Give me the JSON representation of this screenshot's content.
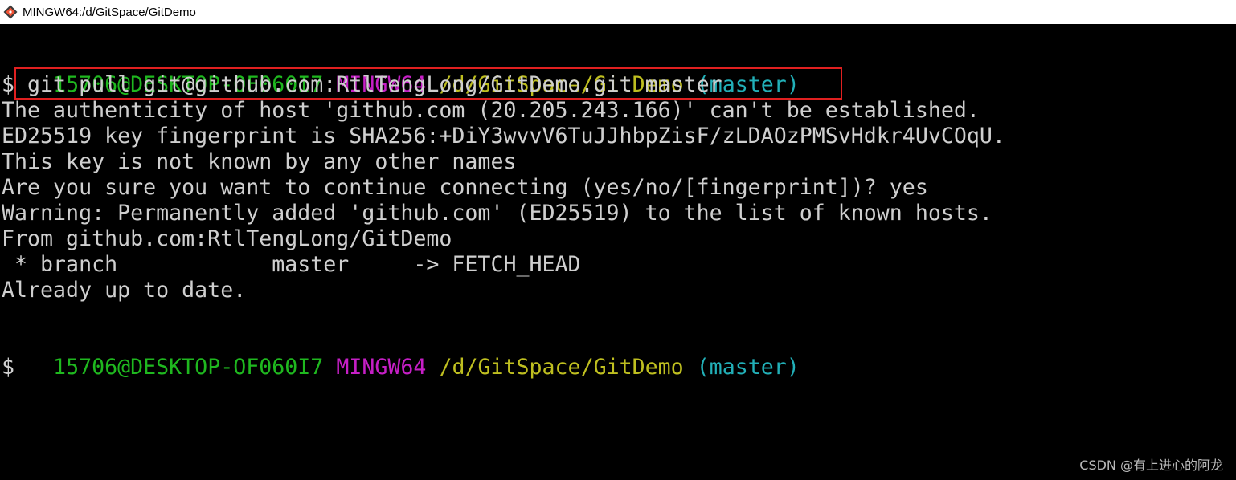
{
  "window": {
    "title": "MINGW64:/d/GitSpace/GitDemo",
    "icon": "git-bash-icon"
  },
  "prompt1": {
    "user": "15706@DESKTOP-OF060I7",
    "system": "MINGW64",
    "path": "/d/GitSpace/GitDemo",
    "branch": "(master)"
  },
  "command": {
    "symbol": "$",
    "text": " git pull git@github.com:RtlTengLong/GitDemo.git master"
  },
  "output": [
    "The authenticity of host 'github.com (20.205.243.166)' can't be established.",
    "ED25519 key fingerprint is SHA256:+DiY3wvvV6TuJJhbpZisF/zLDAOzPMSvHdkr4UvCOqU.",
    "This key is not known by any other names",
    "Are you sure you want to continue connecting (yes/no/[fingerprint])? yes",
    "Warning: Permanently added 'github.com' (ED25519) to the list of known hosts.",
    "From github.com:RtlTengLong/GitDemo",
    " * branch            master     -> FETCH_HEAD",
    "Already up to date."
  ],
  "prompt2": {
    "user": "15706@DESKTOP-OF060I7",
    "system": "MINGW64",
    "path": "/d/GitSpace/GitDemo",
    "branch": "(master)"
  },
  "cursor_line": {
    "symbol": "$"
  },
  "highlight_color": "#e02020",
  "watermark": "CSDN @有上进心的阿龙"
}
